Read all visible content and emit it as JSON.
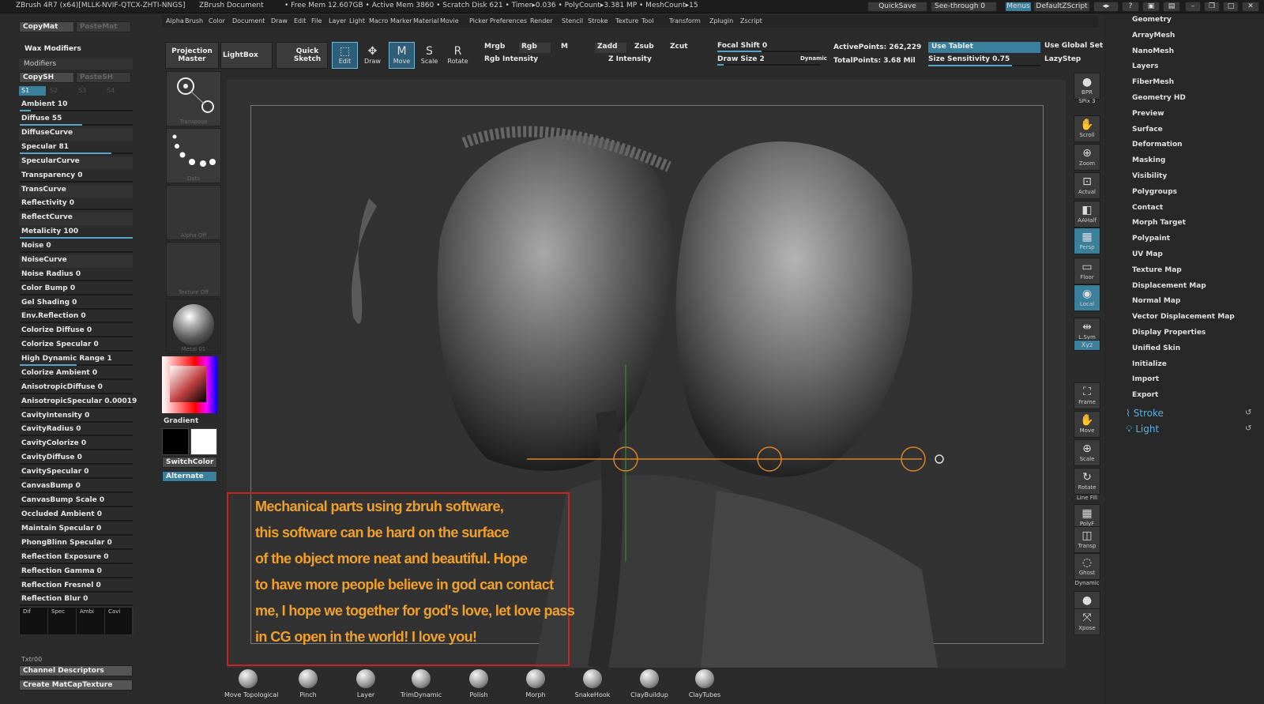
{
  "titlebar": {
    "app": "ZBrush 4R7 (x64)[MLLK-NVIF-QTCX-ZHTI-NNGS]",
    "doc": "ZBrush Document",
    "stats": "• Free Mem 12.607GB • Active Mem 3860 • Scratch Disk 621 • Timer▸0.036 • PolyCount▸3.381 MP • MeshCount▸15",
    "quicksave": "QuickSave",
    "seethrough": "See-through 0",
    "menus": "Menus",
    "script": "DefaultZScript"
  },
  "menubar": [
    "Alpha",
    "Brush",
    "Color",
    "Document",
    "Draw",
    "Edit",
    "File",
    "Layer",
    "Light",
    "Macro",
    "Marker",
    "Material",
    "Movie",
    "Picker",
    "Preferences",
    "Render",
    "Stencil",
    "Stroke",
    "Texture",
    "Tool",
    "Transform",
    "Zplugin",
    "Zscript"
  ],
  "leftpanel": {
    "top_button": "CopyMat",
    "top_button2": "PasteMat",
    "section": "Wax Modifiers",
    "subsection": "Modifiers",
    "copy": "CopySH",
    "paste": "PasteSH",
    "tabs": [
      "S1",
      "S2",
      "S3",
      "S4"
    ],
    "sliders": [
      {
        "label": "Ambient 10",
        "value": 0.1
      },
      {
        "label": "Diffuse 55",
        "value": 0.55
      },
      {
        "label": "DiffuseCurve",
        "value": null
      },
      {
        "label": "Specular 81",
        "value": 0.81
      },
      {
        "label": "SpecularCurve",
        "value": null
      },
      {
        "label": "Transparency 0",
        "value": 0
      },
      {
        "label": "TransCurve",
        "value": null
      },
      {
        "label": "Reflectivity 0",
        "value": 0
      },
      {
        "label": "ReflectCurve",
        "value": null
      },
      {
        "label": "Metalicity 100",
        "value": 1.0
      },
      {
        "label": "Noise 0",
        "value": 0
      },
      {
        "label": "NoiseCurve",
        "value": null
      },
      {
        "label": "Noise Radius 0",
        "value": 0
      },
      {
        "label": "Color Bump 0",
        "value": 0
      },
      {
        "label": "Gel Shading 0",
        "value": 0
      },
      {
        "label": "Env.Reflection 0",
        "value": 0
      },
      {
        "label": "Colorize Diffuse 0",
        "value": 0
      },
      {
        "label": "Colorize Specular 0",
        "value": 0
      },
      {
        "label": "High Dynamic Range 1",
        "value": 0.5
      },
      {
        "label": "Colorize Ambient 0",
        "value": 0
      },
      {
        "label": "AnisotropicDiffuse 0",
        "value": 0
      },
      {
        "label": "AnisotropicSpecular 0.00019",
        "value": 0
      },
      {
        "label": "CavityIntensity 0",
        "value": 0
      },
      {
        "label": "CavityRadius 0",
        "value": 0
      },
      {
        "label": "CavityColorize 0",
        "value": 0
      },
      {
        "label": "CavityDiffuse 0",
        "value": 0
      },
      {
        "label": "CavitySpecular 0",
        "value": 0
      },
      {
        "label": "CanvasBump 0",
        "value": 0
      },
      {
        "label": "CanvasBump Scale 0",
        "value": 0
      },
      {
        "label": "Occluded Ambient 0",
        "value": 0
      },
      {
        "label": "Maintain Specular 0",
        "value": 0
      },
      {
        "label": "PhongBlinn Specular 0",
        "value": 0
      },
      {
        "label": "Reflection Exposure 0",
        "value": 0
      },
      {
        "label": "Reflection Gamma 0",
        "value": 0
      },
      {
        "label": "Reflection Fresnel 0",
        "value": 0
      },
      {
        "label": "Reflection Blur 0",
        "value": 0
      }
    ],
    "channels": [
      "Dif",
      "Spec",
      "Ambi",
      "Cavi"
    ],
    "txtr": "Txtr00",
    "channel_desc": "Channel Descriptors",
    "create_matcap": "Create MatCapTexture"
  },
  "col2": {
    "transpose": "Transpose",
    "dots": "Dots",
    "alpha": "Alpha Off",
    "texture": "Texture Off",
    "material": "Metal 01",
    "gradient": "Gradient",
    "switchcolor": "SwitchColor",
    "alternate": "Alternate"
  },
  "toolbar": {
    "projection": "Projection Master",
    "lightbox": "LightBox",
    "quicksketch": "Quick Sketch",
    "edit": "Edit",
    "draw": "Draw",
    "move": "Move",
    "scale": "Scale",
    "rotate": "Rotate",
    "mrgb": "Mrgb",
    "rgb": "Rgb",
    "m": "M",
    "rgb_intensity": "Rgb Intensity",
    "zadd": "Zadd",
    "zsub": "Zsub",
    "zcut": "Zcut",
    "z_intensity": "Z Intensity",
    "focal_shift": "Focal Shift 0",
    "draw_size": "Draw Size 2",
    "dynamic": "Dynamic",
    "active_points": "ActivePoints: 262,229",
    "total_points": "TotalPoints: 3.68 Mil",
    "use_tablet": "Use Tablet",
    "size_sensitivity": "Size Sensitivity 0.75",
    "use_global": "Use Global Set",
    "lazystep": "LazyStep"
  },
  "rightcol": [
    {
      "label": "BPR",
      "icon": "bpr-icon"
    },
    {
      "label": "SPix 3",
      "icon": ""
    },
    {
      "label": "Scroll",
      "icon": "scroll-icon"
    },
    {
      "label": "Zoom",
      "icon": "zoom-icon"
    },
    {
      "label": "Actual",
      "icon": "actual-icon"
    },
    {
      "label": "AAHalf",
      "icon": "aahalf-icon"
    },
    {
      "label": "Persp",
      "icon": "persp-icon"
    },
    {
      "label": "Floor",
      "icon": "floor-icon"
    },
    {
      "label": "Local",
      "icon": "local-icon"
    },
    {
      "label": "L.Sym",
      "icon": "lsym-icon"
    },
    {
      "label": "Xyz",
      "icon": "xyz-icon"
    },
    {
      "label": "Frame",
      "icon": "frame-icon"
    },
    {
      "label": "Move",
      "icon": "move-icon"
    },
    {
      "label": "Scale",
      "icon": "scale-icon"
    },
    {
      "label": "Rotate",
      "icon": "rotate-icon"
    },
    {
      "label": "Line Fill",
      "icon": ""
    },
    {
      "label": "PolyF",
      "icon": "polyf-icon"
    },
    {
      "label": "Transp",
      "icon": "transp-icon"
    },
    {
      "label": "Ghost",
      "icon": "ghost-icon"
    },
    {
      "label": "Dynamic",
      "icon": ""
    },
    {
      "label": "Solo",
      "icon": "solo-icon"
    },
    {
      "label": "Xpose",
      "icon": "xpose-icon"
    }
  ],
  "rightmenu": {
    "items": [
      "Geometry",
      "ArrayMesh",
      "NanoMesh",
      "Layers",
      "FiberMesh",
      "Geometry HD",
      "Preview",
      "Surface",
      "Deformation",
      "Masking",
      "Visibility",
      "Polygroups",
      "Contact",
      "Morph Target",
      "Polypaint",
      "UV Map",
      "Texture Map",
      "Displacement Map",
      "Normal Map",
      "Vector Displacement Map",
      "Display Properties",
      "Unified Skin",
      "Initialize",
      "Import",
      "Export"
    ],
    "stroke": "Stroke",
    "light": "Light"
  },
  "note": [
    "Mechanical parts using zbruh software,",
    "this software can be hard on the surface",
    "of the object more neat and beautiful. Hope",
    " to have more people believe in god can contact",
    " me, I hope we together for god's love, let love pass",
    "in CG open in the world! I love you!"
  ],
  "brushes": [
    "Move Topological",
    "Pinch",
    "Layer",
    "TrimDynamic",
    "Polish",
    "Morph",
    "SnakeHook",
    "ClayBuildup",
    "ClayTubes"
  ],
  "colors": {
    "accent": "#5aa3c8",
    "note_text": "#f0a02a",
    "note_border": "#c82222",
    "menu_link": "#5ab0e0"
  }
}
